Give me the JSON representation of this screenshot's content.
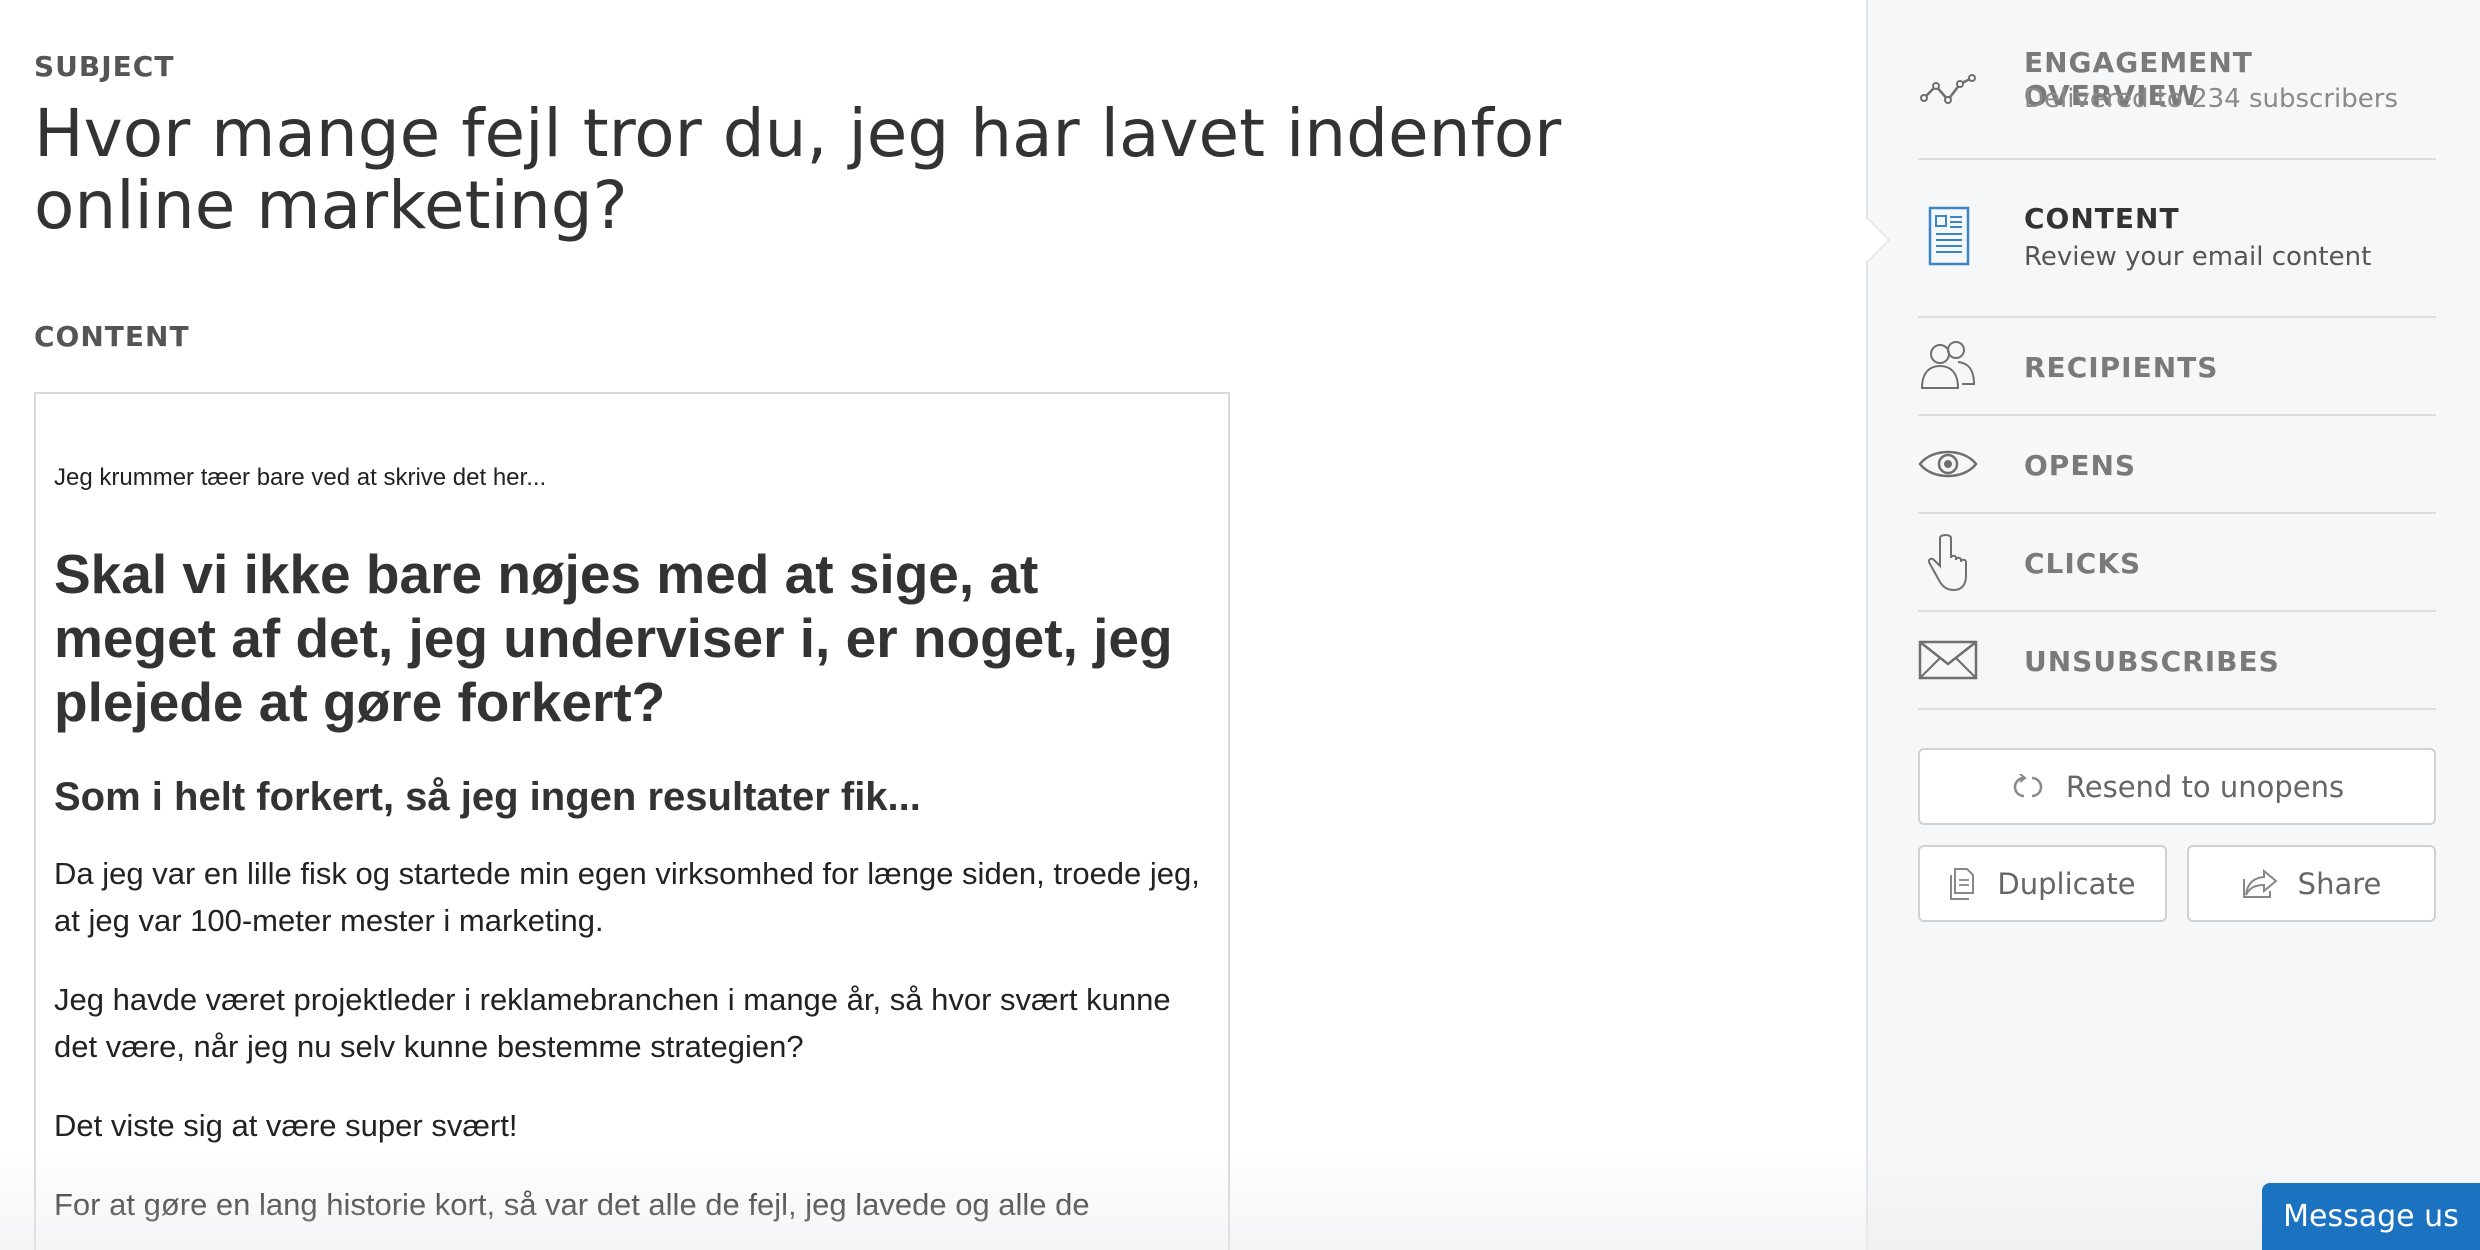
{
  "main": {
    "subject_label": "SUBJECT",
    "subject_title": "Hvor mange fejl tror du, jeg har lavet indenfor online marketing?",
    "content_label": "CONTENT",
    "email": {
      "preheader": "Jeg krummer tæer bare ved at skrive det her...",
      "heading1": "Skal vi ikke bare nøjes med at sige, at meget af det, jeg underviser i, er noget, jeg plejede at gøre forkert?",
      "heading2": "Som i helt forkert, så jeg ingen resultater fik...",
      "paragraphs": [
        "Da jeg var en lille fisk og startede min egen virksomhed for længe siden, troede jeg, at jeg var 100-meter mester i marketing.",
        "Jeg havde været projektleder i reklamebranchen i mange år, så hvor svært kunne det være, når jeg nu selv kunne bestemme strategien?",
        "Det viste sig at være super svært!",
        "For at gøre en lang historie kort, så var det alle de fejl, jeg lavede og alle de"
      ]
    }
  },
  "sidebar": {
    "items": [
      {
        "title": "ENGAGEMENT OVERVIEW",
        "subtitle": "Delivered to 234 subscribers",
        "icon": "chart-line-icon"
      },
      {
        "title": "CONTENT",
        "subtitle": "Review your email content",
        "icon": "document-icon",
        "active": true
      },
      {
        "title": "RECIPIENTS",
        "icon": "users-icon"
      },
      {
        "title": "OPENS",
        "icon": "eye-icon"
      },
      {
        "title": "CLICKS",
        "icon": "pointer-hand-icon"
      },
      {
        "title": "UNSUBSCRIBES",
        "icon": "envelope-icon"
      }
    ],
    "buttons": {
      "resend": "Resend to unopens",
      "duplicate": "Duplicate",
      "share": "Share"
    }
  },
  "chat": {
    "label": "Message us"
  },
  "colors": {
    "accent_blue": "#1b72c0",
    "content_icon_blue": "#3a86c8",
    "sidebar_bg": "#f6f7f8"
  }
}
